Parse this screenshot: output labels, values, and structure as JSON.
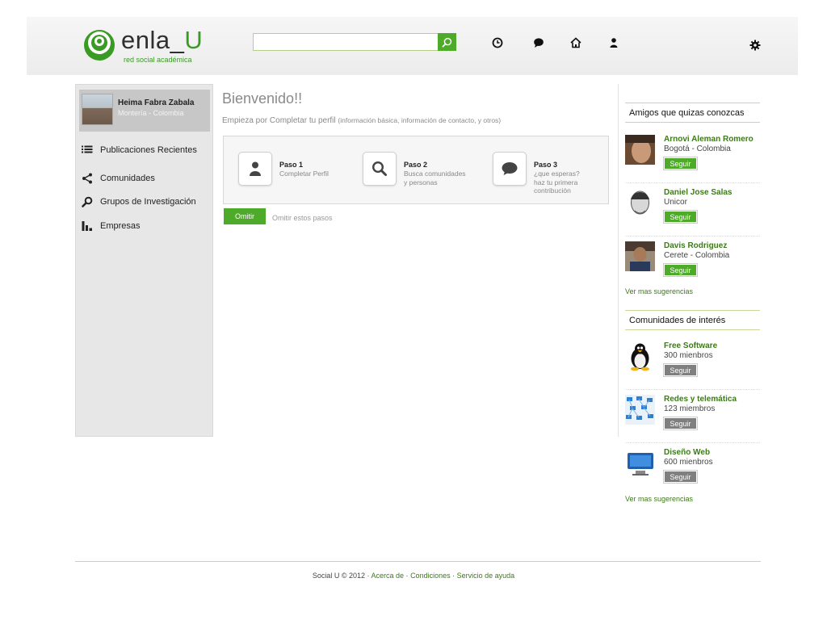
{
  "logo": {
    "name": "enla_",
    "accent": "U",
    "tagline": "red social académica"
  },
  "search": {
    "value": "",
    "placeholder": ""
  },
  "nav": [
    "clock-icon",
    "chat-icon",
    "home-icon",
    "user-icon",
    "gear-icon"
  ],
  "profile": {
    "name": "Heima Fabra Zabala",
    "location": "Montería - Colombia"
  },
  "sidebar": {
    "items": [
      {
        "label": "Publicaciones Recientes",
        "icon": "list-icon"
      },
      {
        "label": "Comunidades",
        "icon": "share-icon"
      },
      {
        "label": "Grupos de Investigación",
        "icon": "magnifier-icon"
      },
      {
        "label": "Empresas",
        "icon": "bar-chart-icon"
      }
    ]
  },
  "main": {
    "title": "Bienvenido!!",
    "subtitle": "Empieza por Completar tu perfil",
    "subtitle_note": "(información básica, información de contacto, y otros)",
    "steps": [
      {
        "title": "Paso 1",
        "desc": [
          "Completar Perfil"
        ],
        "icon": "person-icon"
      },
      {
        "title": "Paso 2",
        "desc": [
          "Busca comunidades",
          "y personas"
        ],
        "icon": "search-icon"
      },
      {
        "title": "Paso 3",
        "desc": [
          "¿que esperas?",
          "haz tu primera",
          "contribución"
        ],
        "icon": "speech-bubble-icon"
      }
    ],
    "omit_button": "Omitir",
    "omit_link": "Omitir estos pasos"
  },
  "friends": {
    "heading": "Amigos que quizas conozcas",
    "items": [
      {
        "name": "Arnovi Aleman Romero",
        "sub": "Bogotá - Colombia",
        "button": "Seguir"
      },
      {
        "name": "Daniel Jose Salas",
        "sub": "Unicor",
        "button": "Seguir"
      },
      {
        "name": "Davis Rodriguez",
        "sub": "Cerete  - Colombia",
        "button": "Seguir"
      }
    ],
    "more": "Ver mas sugerencias"
  },
  "communities": {
    "heading": "Comunidades de interés",
    "items": [
      {
        "name": "Free Software",
        "sub": "300 mienbros",
        "button": "Seguir"
      },
      {
        "name": "Redes y telemática",
        "sub": "123 miembros",
        "button": "Seguir"
      },
      {
        "name": "Diseño Web",
        "sub": "600 mienbros",
        "button": "Seguir"
      }
    ],
    "more": "Ver mas sugerencias"
  },
  "footer": {
    "copyright": "Social U © 2012 ·",
    "links": [
      "Acerca de",
      "Condiciones",
      "Servicio de ayuda"
    ],
    "sep": "·"
  },
  "colors": {
    "accent": "#4eab2a",
    "link": "#3d7a19",
    "sidebar_bg": "#e7e7e7"
  }
}
